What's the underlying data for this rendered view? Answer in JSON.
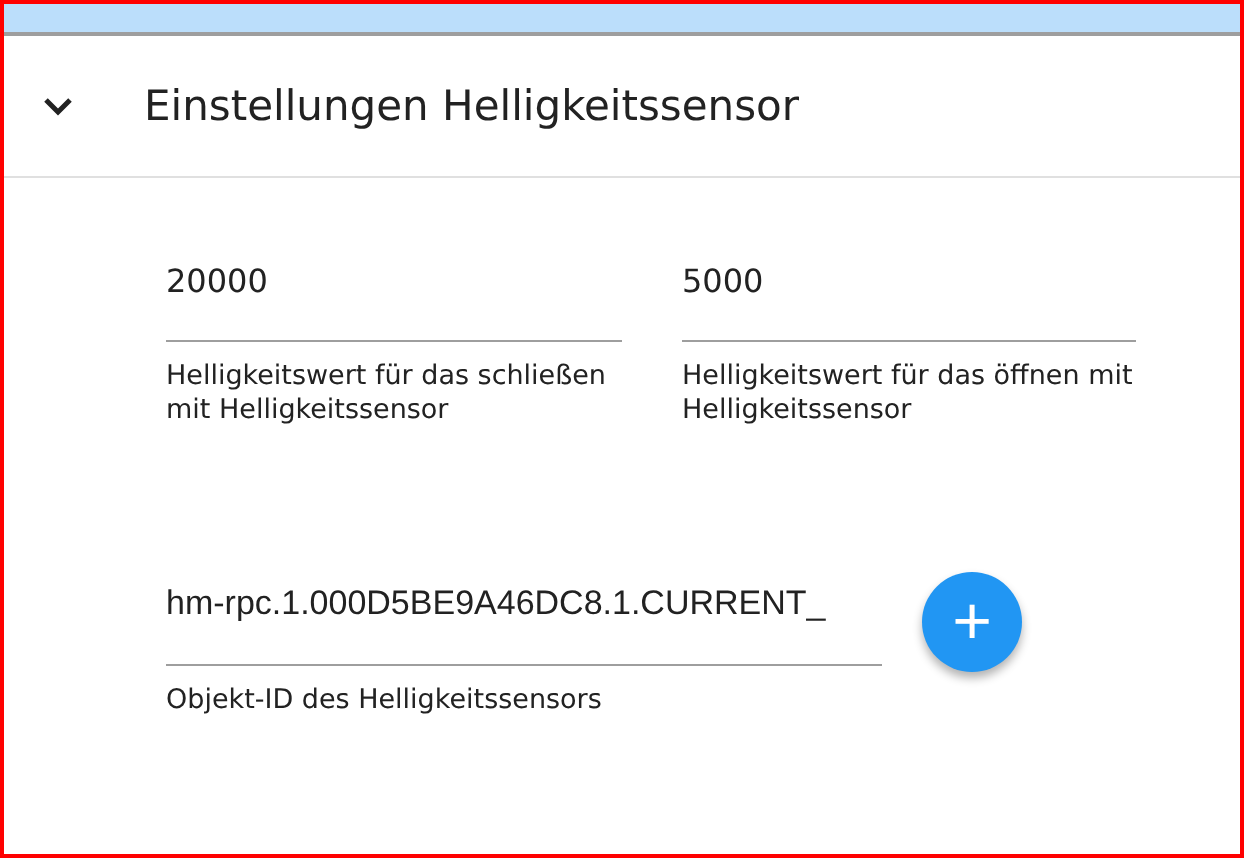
{
  "panel": {
    "title": "Einstellungen Helligkeitssensor",
    "expanded": true
  },
  "fields": [
    {
      "value": "20000",
      "helper": "Helligkeitswert für das schließen mit Helligkeitssensor"
    },
    {
      "value": "5000",
      "helper": "Helligkeitswert für das öffnen mit Helligkeitssensor"
    }
  ],
  "object_field": {
    "value": "hm-rpc.1.000D5BE9A46DC8.1.CURRENT_",
    "helper": "Objekt-ID des Helligkeitssensors"
  },
  "add_button": {
    "label": "+"
  }
}
